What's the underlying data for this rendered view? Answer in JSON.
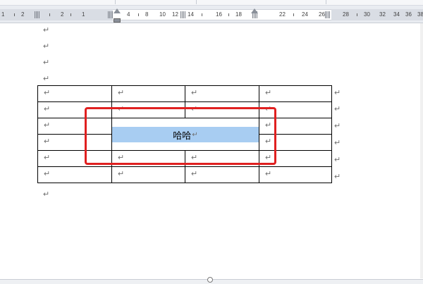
{
  "ruler": {
    "numbers_left": [
      "1",
      "2",
      "1"
    ],
    "numbers_main": [
      "2",
      "4",
      "8",
      "10",
      "12",
      "14",
      "16",
      "18"
    ],
    "numbers_right": [
      "22",
      "24",
      "26",
      "28",
      "30",
      "32",
      "34",
      "36",
      "38"
    ]
  },
  "paragraph_mark": "↵",
  "table": {
    "merged_text": "哈哈"
  }
}
